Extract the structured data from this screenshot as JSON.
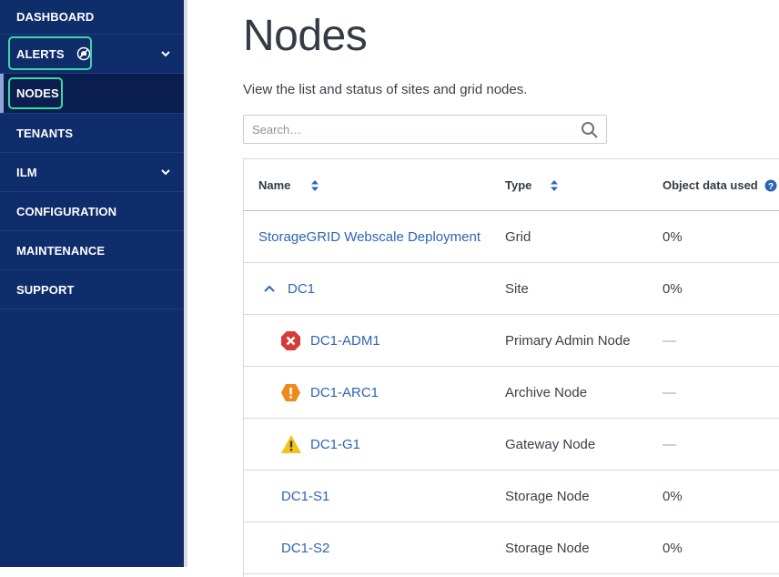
{
  "sidebar": {
    "items": [
      {
        "label": "DASHBOARD"
      },
      {
        "label": "ALERTS"
      },
      {
        "label": "NODES"
      },
      {
        "label": "TENANTS"
      },
      {
        "label": "ILM"
      },
      {
        "label": "CONFIGURATION"
      },
      {
        "label": "MAINTENANCE"
      },
      {
        "label": "SUPPORT"
      }
    ]
  },
  "main": {
    "title": "Nodes",
    "subtitle": "View the list and status of sites and grid nodes.",
    "search": {
      "placeholder": "Search…"
    }
  },
  "table": {
    "headers": {
      "name": "Name",
      "type": "Type",
      "object_data_used": "Object data used"
    },
    "rows": [
      {
        "name": "StorageGRID Webscale Deployment",
        "type": "Grid",
        "used": "0%"
      },
      {
        "name": "DC1",
        "type": "Site",
        "used": "0%"
      },
      {
        "name": "DC1-ADM1",
        "type": "Primary Admin Node",
        "used": "—",
        "status_icon": "critical-alert-icon"
      },
      {
        "name": "DC1-ARC1",
        "type": "Archive Node",
        "used": "—",
        "status_icon": "major-alert-icon"
      },
      {
        "name": "DC1-G1",
        "type": "Gateway Node",
        "used": "—",
        "status_icon": "minor-alert-icon"
      },
      {
        "name": "DC1-S1",
        "type": "Storage Node",
        "used": "0%"
      },
      {
        "name": "DC1-S2",
        "type": "Storage Node",
        "used": "0%"
      }
    ]
  },
  "colors": {
    "sidebar": "#0f2c6b",
    "link": "#2e64b4",
    "highlight": "#3dd6a6",
    "critical": "#d63a3a",
    "major": "#f0891c",
    "minor": "#f5c21c"
  }
}
